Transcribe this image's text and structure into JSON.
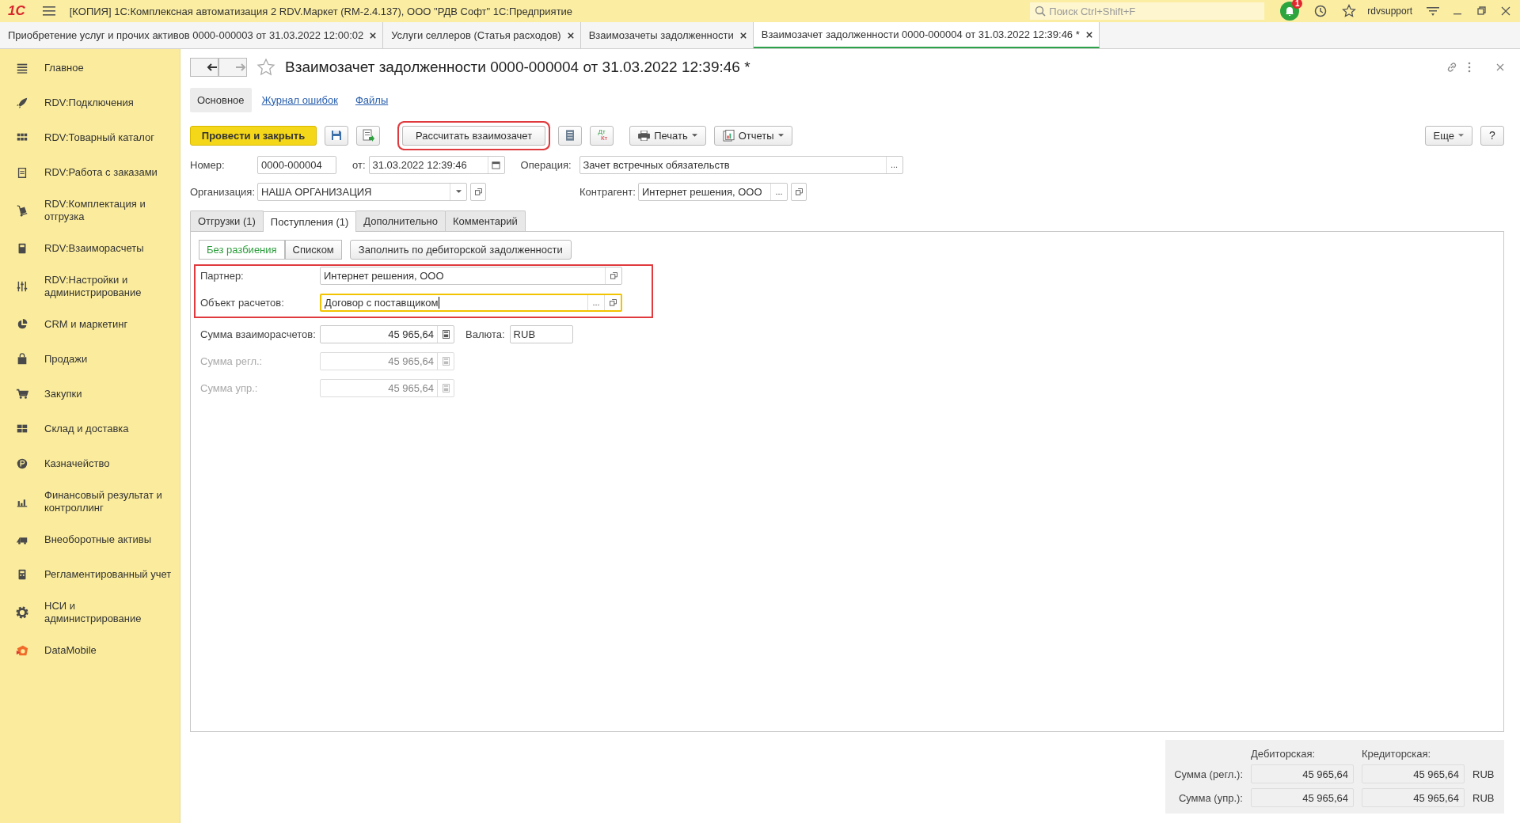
{
  "app_bar": {
    "logo": "1С",
    "title": "[КОПИЯ] 1С:Комплексная автоматизация 2 RDV.Маркет (RM-2.4.137), ООО \"РДВ Софт\" 1С:Предприятие",
    "search": {
      "placeholder": "Поиск Ctrl+Shift+F"
    },
    "notification_count": "1",
    "user": "rdvsupport"
  },
  "open_tabs": [
    {
      "label": "Приобретение услуг и прочих активов 0000-000003 от 31.03.2022 12:00:02",
      "selected": false
    },
    {
      "label": "Услуги селлеров (Статья расходов)",
      "selected": false
    },
    {
      "label": "Взаимозачеты задолженности",
      "selected": false
    },
    {
      "label": "Взаимозачет задолженности 0000-000004 от 31.03.2022 12:39:46 *",
      "selected": true
    }
  ],
  "sidebar": {
    "items": [
      {
        "label": "Главное"
      },
      {
        "label": "RDV:Подключения"
      },
      {
        "label": "RDV:Товарный каталог"
      },
      {
        "label": "RDV:Работа с заказами"
      },
      {
        "label": "RDV:Комплектация и отгрузка"
      },
      {
        "label": "RDV:Взаиморасчеты"
      },
      {
        "label": "RDV:Настройки и администрирование"
      },
      {
        "label": "CRM и маркетинг"
      },
      {
        "label": "Продажи"
      },
      {
        "label": "Закупки"
      },
      {
        "label": "Склад и доставка"
      },
      {
        "label": "Казначейство"
      },
      {
        "label": "Финансовый результат и контроллинг"
      },
      {
        "label": "Внеоборотные активы"
      },
      {
        "label": "Регламентированный учет"
      },
      {
        "label": "НСИ и администрирование"
      },
      {
        "label": "DataMobile"
      }
    ]
  },
  "document": {
    "title": "Взаимозачет задолженности 0000-000004 от 31.03.2022 12:39:46 *",
    "sections": [
      {
        "label": "Основное",
        "selected": true
      },
      {
        "label": "Журнал ошибок",
        "selected": false
      },
      {
        "label": "Файлы",
        "selected": false
      }
    ],
    "toolbar": {
      "post_button": "Провести и закрыть",
      "calculate_button": {
        "label": "Рассчитать взаимозачет",
        "highlighted": true
      },
      "dtkt_icon": {
        "debit": "Дт",
        "credit": "Кт"
      },
      "print_button": "Печать",
      "reports_button": "Отчеты",
      "more_button": "Еще",
      "help_button": "?"
    },
    "header_fields": {
      "number": {
        "label": "Номер:",
        "value": "0000-000004"
      },
      "date": {
        "label": "от:",
        "value": "31.03.2022 12:39:46"
      },
      "operation": {
        "label": "Операция:",
        "value": "Зачет встречных обязательств",
        "choice": "..."
      },
      "organization": {
        "label": "Организация:",
        "value": "НАША ОРГАНИЗАЦИЯ"
      },
      "counterparty": {
        "label": "Контрагент:",
        "value": "Интернет решения, ООО",
        "choice": "..."
      }
    },
    "tabs": [
      {
        "label": "Отгрузки (1)",
        "selected": false
      },
      {
        "label": "Поступления (1)",
        "selected": true
      },
      {
        "label": "Дополнительно",
        "selected": false
      },
      {
        "label": "Комментарий",
        "selected": false
      }
    ],
    "mode_toggle": [
      {
        "label": "Без разбиения",
        "selected": true
      },
      {
        "label": "Списком",
        "selected": false
      }
    ],
    "fill_button": "Заполнить по дебиторской задолженности",
    "partner_group": {
      "highlighted": true,
      "partner": {
        "label": "Партнер:",
        "value": "Интернет решения, ООО"
      },
      "settlement_object": {
        "label": "Объект расчетов:",
        "value": "Договор с поставщиком",
        "choice": "...",
        "focused": true
      }
    },
    "amount_fields": [
      {
        "label": "Сумма взаиморасчетов:",
        "value": "45 965,64",
        "disabled": false
      },
      {
        "label": "Сумма регл.:",
        "value": "45 965,64",
        "disabled": true
      },
      {
        "label": "Сумма упр.:",
        "value": "45 965,64",
        "disabled": true
      }
    ],
    "currency": {
      "label": "Валюта:",
      "value": "RUB"
    },
    "totals": {
      "columns": [
        "Дебиторская:",
        "Кредиторская:"
      ],
      "rows": [
        {
          "label": "Сумма (регл.):",
          "debit": "45 965,64",
          "credit": "45 965,64",
          "currency": "RUB"
        },
        {
          "label": "Сумма (упр.):",
          "debit": "45 965,64",
          "credit": "45 965,64",
          "currency": "RUB"
        }
      ]
    }
  }
}
